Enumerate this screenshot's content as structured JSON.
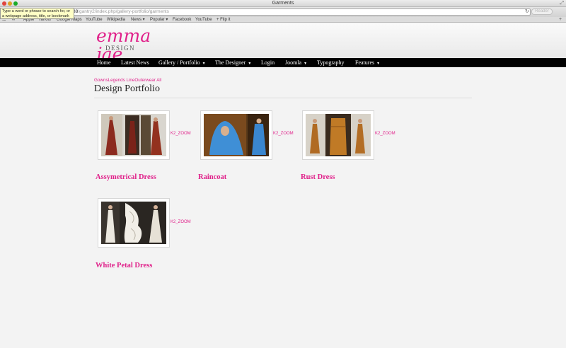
{
  "browser": {
    "window_title": "Garments",
    "address_prefix": "88",
    "address_rest": "/gantry2/index.php/gallery-portfolio/garments",
    "reader_label": "Reader",
    "tooltip": "Type a word or phrase to search for, or a webpage address, title, or bookmark",
    "bookmarks": [
      "Apple",
      "Yahoo!",
      "Google Maps",
      "YouTube",
      "Wikipedia",
      "News ▾",
      "Popular ▾",
      "Facebook",
      "YouTube",
      "+ Flip it"
    ]
  },
  "site": {
    "logo_script": "emma jae",
    "logo_sub": "DESIGN",
    "brand_color": "#e0218a"
  },
  "nav": {
    "items": [
      {
        "label": "Home",
        "dropdown": false
      },
      {
        "label": "Latest News",
        "dropdown": false
      },
      {
        "label": "Gallery / Portfolio",
        "dropdown": true
      },
      {
        "label": "The Designer",
        "dropdown": true
      },
      {
        "label": "Login",
        "dropdown": false
      },
      {
        "label": "Joomla",
        "dropdown": true
      },
      {
        "label": "Typography",
        "dropdown": false
      },
      {
        "label": "Features",
        "dropdown": true
      }
    ]
  },
  "main": {
    "categories": "GownsLegends LineOuterwear All",
    "page_title": "Design Portfolio",
    "items": [
      {
        "title": "Assymetrical Dress",
        "zoom": "K2_ZOOM"
      },
      {
        "title": "Raincoat",
        "zoom": "K2_ZOOM"
      },
      {
        "title": "Rust Dress",
        "zoom": "K2_ZOOM"
      },
      {
        "title": "White Petal Dress",
        "zoom": "K2_ZOOM"
      }
    ]
  }
}
